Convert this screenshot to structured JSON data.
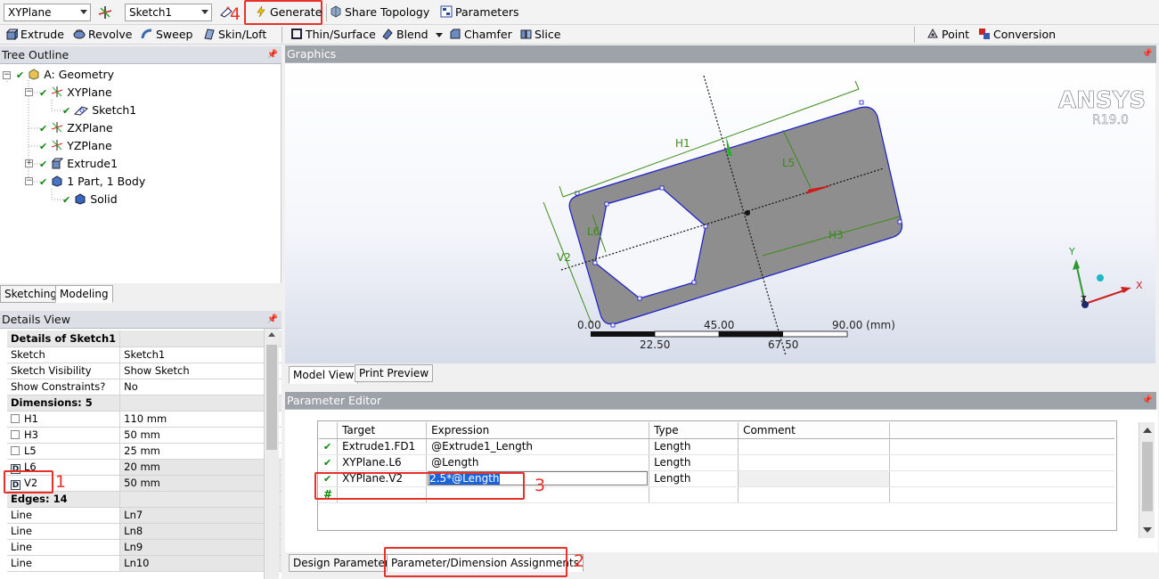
{
  "toolbar1": {
    "plane_select": "XYPlane",
    "sketch_select": "Sketch1",
    "generate": "Generate",
    "share_topology": "Share Topology",
    "parameters": "Parameters"
  },
  "toolbar2": {
    "extrude": "Extrude",
    "revolve": "Revolve",
    "sweep": "Sweep",
    "skin_loft": "Skin/Loft",
    "thin_surface": "Thin/Surface",
    "blend": "Blend",
    "chamfer": "Chamfer",
    "slice": "Slice",
    "point": "Point",
    "conversion": "Conversion"
  },
  "tree": {
    "title": "Tree Outline",
    "items": [
      {
        "label": "A: Geometry"
      },
      {
        "label": "XYPlane"
      },
      {
        "label": "Sketch1"
      },
      {
        "label": "ZXPlane"
      },
      {
        "label": "YZPlane"
      },
      {
        "label": "Extrude1"
      },
      {
        "label": "1 Part, 1 Body"
      },
      {
        "label": "Solid"
      }
    ],
    "tabs": [
      "Sketching",
      "Modeling"
    ]
  },
  "details": {
    "title": "Details View",
    "rows": [
      {
        "k": "Details of Sketch1",
        "v": "",
        "group": true
      },
      {
        "k": "Sketch",
        "v": "Sketch1"
      },
      {
        "k": "Sketch Visibility",
        "v": "Show Sketch"
      },
      {
        "k": "Show Constraints?",
        "v": "No"
      },
      {
        "k": "Dimensions: 5",
        "v": "",
        "group": true
      },
      {
        "k": "H1",
        "v": "110 mm",
        "box": "check"
      },
      {
        "k": "H3",
        "v": "50 mm",
        "box": "check"
      },
      {
        "k": "L5",
        "v": "25 mm",
        "box": "check"
      },
      {
        "k": "L6",
        "v": "20 mm",
        "box": "D",
        "shade": true
      },
      {
        "k": "V2",
        "v": "50 mm",
        "box": "D",
        "shade": true
      },
      {
        "k": "Edges: 14",
        "v": "",
        "group": true
      },
      {
        "k": "Line",
        "v": "Ln7",
        "shade": true
      },
      {
        "k": "Line",
        "v": "Ln8",
        "shade": true
      },
      {
        "k": "Line",
        "v": "Ln9",
        "shade": true
      },
      {
        "k": "Line",
        "v": "Ln10",
        "shade": true
      }
    ]
  },
  "graphics": {
    "title": "Graphics",
    "brand": "ANSYS",
    "version": "R19.0",
    "dims": {
      "H1": "H1",
      "L5": "L5",
      "L6": "L6",
      "V2": "V2",
      "H3": "H3"
    },
    "scale_top": [
      "0.00",
      "45.00",
      "90.00 (mm)"
    ],
    "scale_bottom": [
      "22.50",
      "67.50"
    ],
    "axes": {
      "x": "X",
      "y": "Y",
      "z": "Z"
    },
    "tabs": [
      "Model View",
      "Print Preview"
    ]
  },
  "param_editor": {
    "title": "Parameter Editor",
    "columns": [
      "Target",
      "Expression",
      "Type",
      "Comment"
    ],
    "rows": [
      {
        "target": "Extrude1.FD1",
        "expression": "@Extrude1_Length",
        "type": "Length"
      },
      {
        "target": "XYPlane.L6",
        "expression": "@Length",
        "type": "Length"
      },
      {
        "target": "XYPlane.V2",
        "expression": "2.5*@Length",
        "type": "Length"
      }
    ],
    "new_row_marker": "#",
    "tabs": [
      "Design Parameters",
      "Parameter/Dimension Assignments"
    ]
  },
  "annotations": [
    "1",
    "2",
    "3",
    "4"
  ],
  "colors": {
    "annotation_red": "#e8302a",
    "check_green": "#0a8a0a",
    "sketch_blue": "#1a1acc",
    "dim_green": "#3d8a1a"
  }
}
